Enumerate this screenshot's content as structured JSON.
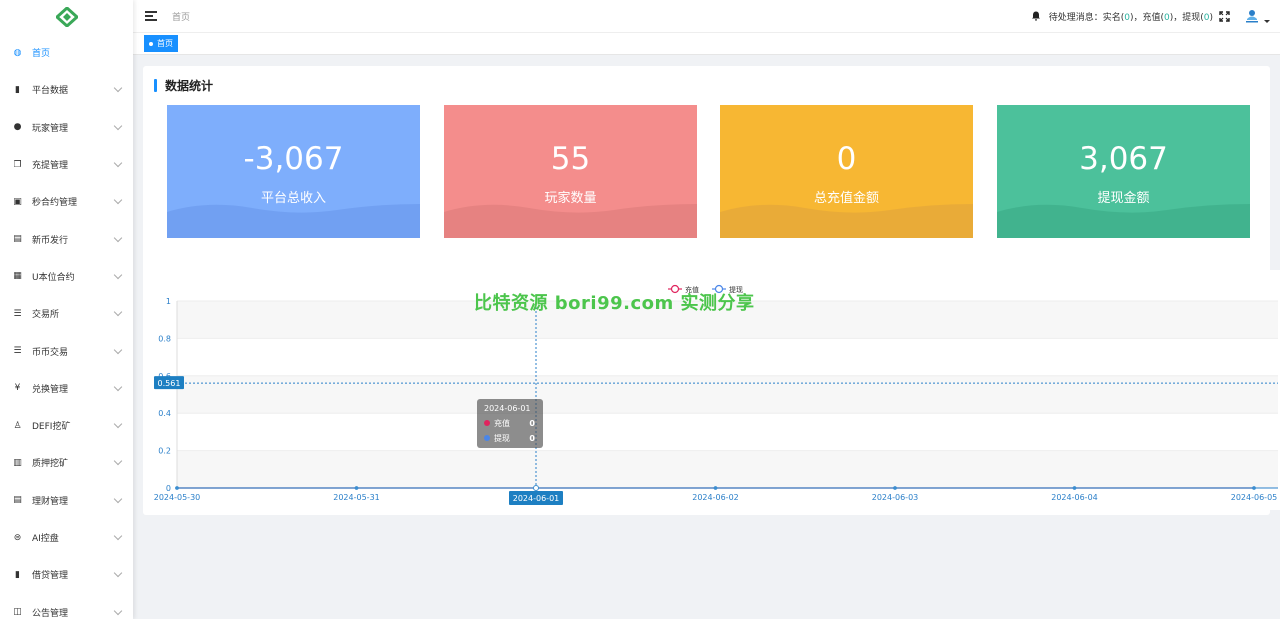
{
  "sidebar": {
    "items": [
      {
        "label": "首页",
        "icon": "dashboard-icon",
        "glyph": "◍",
        "active": true,
        "expandable": false
      },
      {
        "label": "平台数据",
        "icon": "book-icon",
        "glyph": "▮",
        "active": false,
        "expandable": true
      },
      {
        "label": "玩家管理",
        "icon": "user-icon",
        "glyph": "●",
        "active": false,
        "expandable": true
      },
      {
        "label": "充提管理",
        "icon": "copy-icon",
        "glyph": "❐",
        "active": false,
        "expandable": true
      },
      {
        "label": "秒合约管理",
        "icon": "monitor-icon",
        "glyph": "▣",
        "active": false,
        "expandable": true
      },
      {
        "label": "新币发行",
        "icon": "card-icon",
        "glyph": "▤",
        "active": false,
        "expandable": true
      },
      {
        "label": "U本位合约",
        "icon": "grid-icon",
        "glyph": "▦",
        "active": false,
        "expandable": true
      },
      {
        "label": "交易所",
        "icon": "list-icon",
        "glyph": "☰",
        "active": false,
        "expandable": true
      },
      {
        "label": "币币交易",
        "icon": "list-icon",
        "glyph": "☰",
        "active": false,
        "expandable": true
      },
      {
        "label": "兑换管理",
        "icon": "yen-icon",
        "glyph": "¥",
        "active": false,
        "expandable": true
      },
      {
        "label": "DEFI挖矿",
        "icon": "walker-icon",
        "glyph": "♙",
        "active": false,
        "expandable": true
      },
      {
        "label": "质押挖矿",
        "icon": "bar-chart-icon",
        "glyph": "▥",
        "active": false,
        "expandable": true
      },
      {
        "label": "理财管理",
        "icon": "document-icon",
        "glyph": "▤",
        "active": false,
        "expandable": true
      },
      {
        "label": "AI控盘",
        "icon": "robot-icon",
        "glyph": "⊜",
        "active": false,
        "expandable": true
      },
      {
        "label": "借贷管理",
        "icon": "book-icon",
        "glyph": "▮",
        "active": false,
        "expandable": true
      },
      {
        "label": "公告管理",
        "icon": "open-book-icon",
        "glyph": "◫",
        "active": false,
        "expandable": true
      }
    ]
  },
  "header": {
    "breadcrumb": "首页",
    "notice_prefix": "待处理消息：实名(",
    "realname_count": "0",
    "notice_mid1": ")，充值(",
    "recharge_count": "0",
    "notice_mid2": ")，提现(",
    "withdraw_count": "0",
    "notice_suffix": ")"
  },
  "tags": {
    "active_tag": "首页"
  },
  "stats": {
    "title": "数据统计",
    "cards": [
      {
        "value": "-3,067",
        "label": "平台总收入",
        "color": "#7eaefc",
        "wave": "#6f9ef0"
      },
      {
        "value": "55",
        "label": "玩家数量",
        "color": "#f48d8c",
        "wave": "#e3807f"
      },
      {
        "value": "0",
        "label": "总充值金额",
        "color": "#f7b733",
        "wave": "#e6a93a"
      },
      {
        "value": "3,067",
        "label": "提现金额",
        "color": "#4cc19b",
        "wave": "#40b08c"
      }
    ]
  },
  "watermark": "比特资源 bori99.com 实测分享",
  "chart_data": {
    "type": "line",
    "categories": [
      "2024-05-30",
      "2024-05-31",
      "2024-06-01",
      "2024-06-02",
      "2024-06-03",
      "2024-06-04",
      "2024-06-05"
    ],
    "series": [
      {
        "name": "充值",
        "values": [
          0,
          0,
          0,
          0,
          0,
          0,
          0
        ],
        "color": "#e0245e"
      },
      {
        "name": "提现",
        "values": [
          0,
          0,
          0,
          0,
          0,
          0,
          0
        ],
        "color": "#4a86e8"
      }
    ],
    "yticks": [
      "0",
      "0.2",
      "0.4",
      "0.6",
      "0.8",
      "1"
    ],
    "ylim": [
      0,
      1
    ],
    "legend": "top-center",
    "grid": true,
    "crosshair": {
      "y_label": "0.561",
      "x_label": "2024-06-01"
    },
    "tooltip": {
      "title": "2024-06-01",
      "rows": [
        {
          "name": "充值",
          "value": "0",
          "color": "#e0245e"
        },
        {
          "name": "提现",
          "value": "0",
          "color": "#4a86e8"
        }
      ]
    }
  }
}
